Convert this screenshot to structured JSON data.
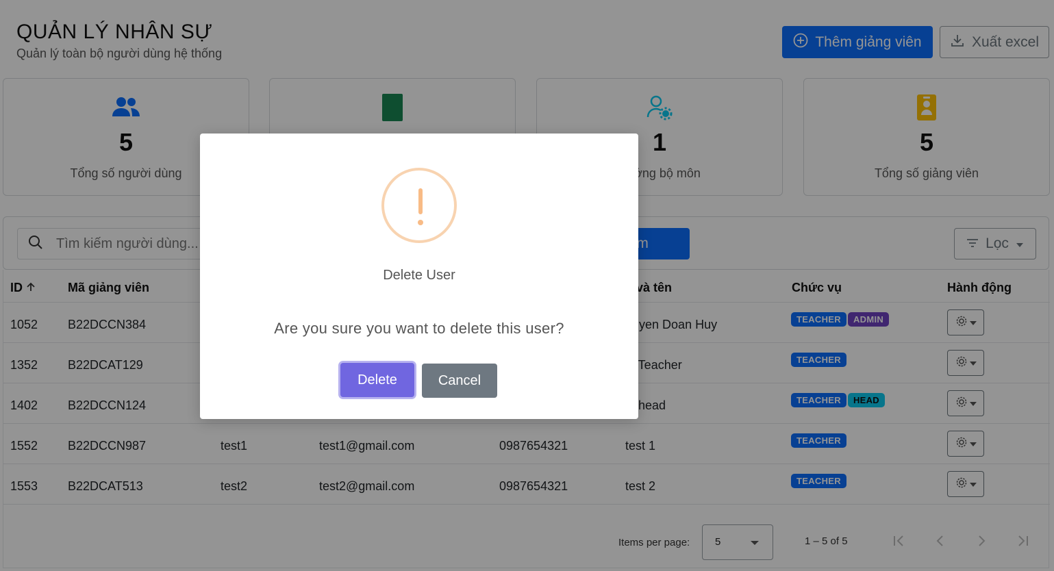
{
  "header": {
    "title": "QUẢN LÝ NHÂN SỰ",
    "subtitle": "Quản lý toàn bộ người dùng hệ thống",
    "add_button": "Thêm giảng viên",
    "export_button": "Xuất excel"
  },
  "stats": [
    {
      "value": "5",
      "label": "Tổng số người dùng",
      "icon": "users-icon",
      "color": "#0d6efd"
    },
    {
      "value": "",
      "label": "",
      "icon": "book-icon",
      "color": "#198754"
    },
    {
      "value": "1",
      "label": "trưởng bộ môn",
      "icon": "user-gear-icon",
      "color": "#0dcaf0"
    },
    {
      "value": "5",
      "label": "Tổng số giảng viên",
      "icon": "id-badge-icon",
      "color": "#ffc107"
    }
  ],
  "search": {
    "placeholder": "Tìm kiếm người dùng...",
    "button": "n kiếm",
    "filter": "Lọc"
  },
  "table": {
    "columns": [
      "ID",
      "Mã giảng viên",
      "",
      "",
      "",
      "ọ và tên",
      "Chức vụ",
      "Hành động"
    ],
    "rows": [
      {
        "id": "1052",
        "code": "B22DCCN384",
        "username": "",
        "email": "",
        "phone": "",
        "name": "guyen Doan Huy",
        "roles": [
          "TEACHER",
          "ADMIN"
        ]
      },
      {
        "id": "1352",
        "code": "B22DCAT129",
        "username": "",
        "email": "",
        "phone": "",
        "name": "st Teacher",
        "roles": [
          "TEACHER"
        ]
      },
      {
        "id": "1402",
        "code": "B22DCCN124",
        "username": "",
        "email": "",
        "phone": "",
        "name": "st head",
        "roles": [
          "TEACHER",
          "HEAD"
        ]
      },
      {
        "id": "1552",
        "code": "B22DCCN987",
        "username": "test1",
        "email": "test1@gmail.com",
        "phone": "0987654321",
        "name": "test 1",
        "roles": [
          "TEACHER"
        ]
      },
      {
        "id": "1553",
        "code": "B22DCAT513",
        "username": "test2",
        "email": "test2@gmail.com",
        "phone": "0987654321",
        "name": "test 2",
        "roles": [
          "TEACHER"
        ]
      }
    ]
  },
  "paginator": {
    "items_label": "Items per page:",
    "page_size": "5",
    "range": "1 – 5 of 5"
  },
  "dialog": {
    "title": "Delete User",
    "message": "Are you sure you want to delete this user?",
    "confirm": "Delete",
    "cancel": "Cancel",
    "icon": "warning-icon",
    "confirm_color": "#7066e0"
  }
}
